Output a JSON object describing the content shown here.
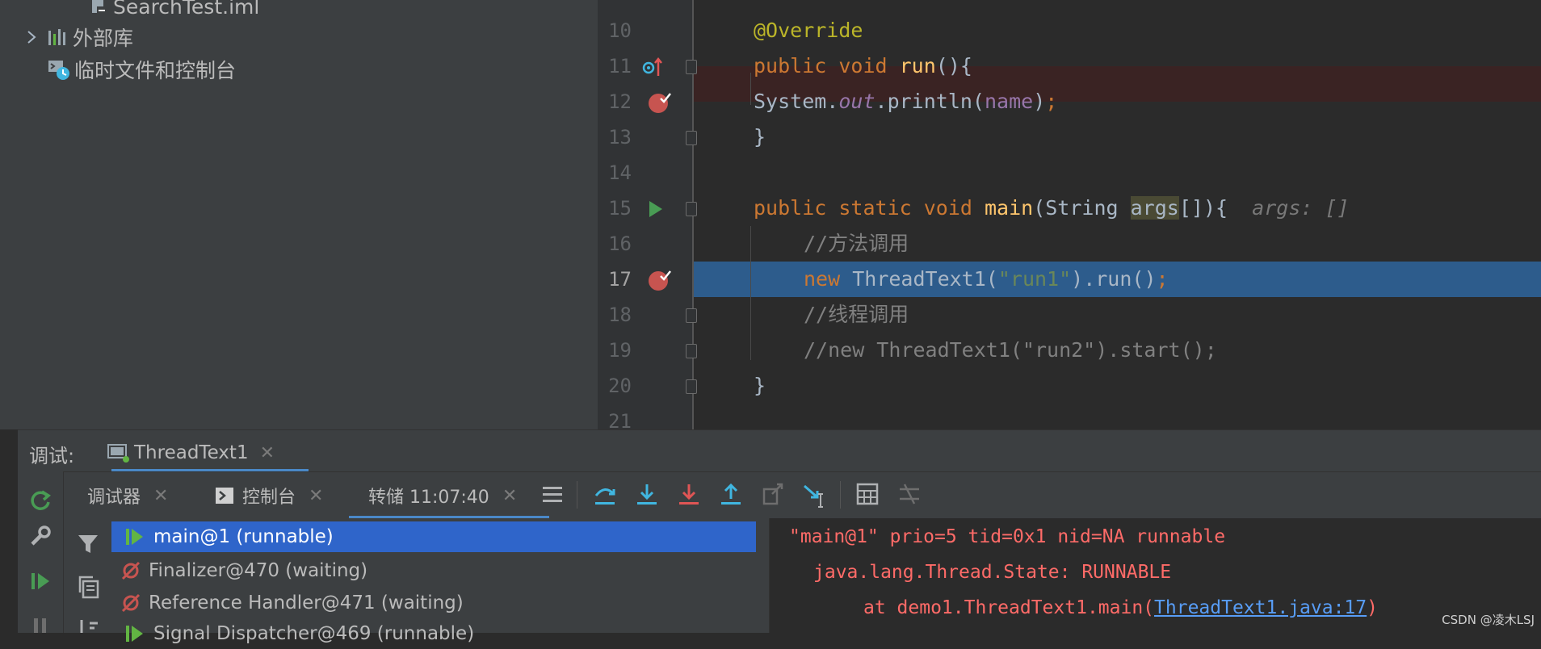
{
  "project_tree": {
    "items": [
      {
        "label": "SearchTest.iml",
        "icon": "module-file-icon"
      },
      {
        "label": "外部库",
        "icon": "library-icon"
      },
      {
        "label": "临时文件和控制台",
        "icon": "scratches-icon"
      }
    ]
  },
  "editor": {
    "lines": [
      {
        "num": "10"
      },
      {
        "num": "11"
      },
      {
        "num": "12"
      },
      {
        "num": "13"
      },
      {
        "num": "14"
      },
      {
        "num": "15"
      },
      {
        "num": "16"
      },
      {
        "num": "17"
      },
      {
        "num": "18"
      },
      {
        "num": "19"
      },
      {
        "num": "20"
      },
      {
        "num": "21"
      }
    ],
    "code": {
      "l10": "@Override",
      "l11_kw": "public void ",
      "l11_fn": "run",
      "l11_rest": "(){",
      "l12_a": "System.",
      "l12_b": "out",
      "l12_c": ".println(",
      "l12_d": "name",
      "l12_e": ")",
      "l12_f": ";",
      "l13": "}",
      "l15_kw": "public static void ",
      "l15_fn": "main",
      "l15_a": "(String ",
      "l15_b": "args",
      "l15_c": "[]){",
      "l15_hint": "args: []",
      "l16": "//方法调用",
      "l17_kw": "new ",
      "l17_a": "ThreadText1(",
      "l17_str": "\"run1\"",
      "l17_b": ").run()",
      "l17_semi": ";",
      "l18": "//线程调用",
      "l19": "//new ThreadText1(\"run2\").start();",
      "l20": "}"
    }
  },
  "debug": {
    "label": "调试:",
    "config_tab": "ThreadText1",
    "tabs": [
      {
        "label": "调试器"
      },
      {
        "label": "控制台"
      },
      {
        "label": "转储 11:07:40"
      }
    ]
  },
  "threads": [
    {
      "label": "main@1 (runnable)",
      "selected": true
    },
    {
      "label": "Finalizer@470 (waiting)"
    },
    {
      "label": "Reference Handler@471 (waiting)"
    },
    {
      "label": "Signal Dispatcher@469 (runnable)"
    }
  ],
  "dump": {
    "line1": "\"main@1\" prio=5 tid=0x1 nid=NA runnable",
    "line2": "java.lang.Thread.State: RUNNABLE",
    "line3_prefix": "at demo1.ThreadText1.main(",
    "line3_link": "ThreadText1.java:17",
    "line3_suffix": ")"
  },
  "watermark": "CSDN @凌木LSJ",
  "colors": {
    "selection": "#2f65ca",
    "current_line": "#2d5c8c",
    "breakpoint_line": "#3a2323",
    "dump_text": "#ff6b68",
    "link": "#589df6"
  }
}
